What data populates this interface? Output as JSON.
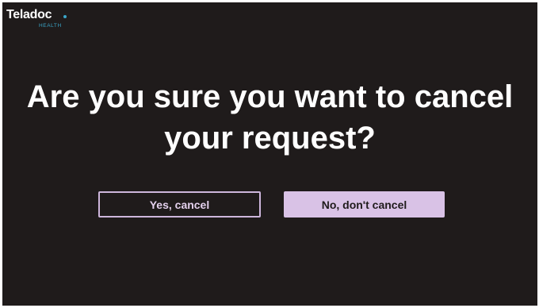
{
  "brand": {
    "name": "Teladoc",
    "sub": "HEALTH",
    "accent_color": "#3aa6c9"
  },
  "dialog": {
    "question": "Are you sure you want to cancel your request?",
    "confirm_label": "Yes, cancel",
    "dismiss_label": "No, don't cancel"
  },
  "colors": {
    "background": "#1f1b1b",
    "button_outline": "#cdb6dc",
    "button_fill": "#d9c2e6"
  }
}
